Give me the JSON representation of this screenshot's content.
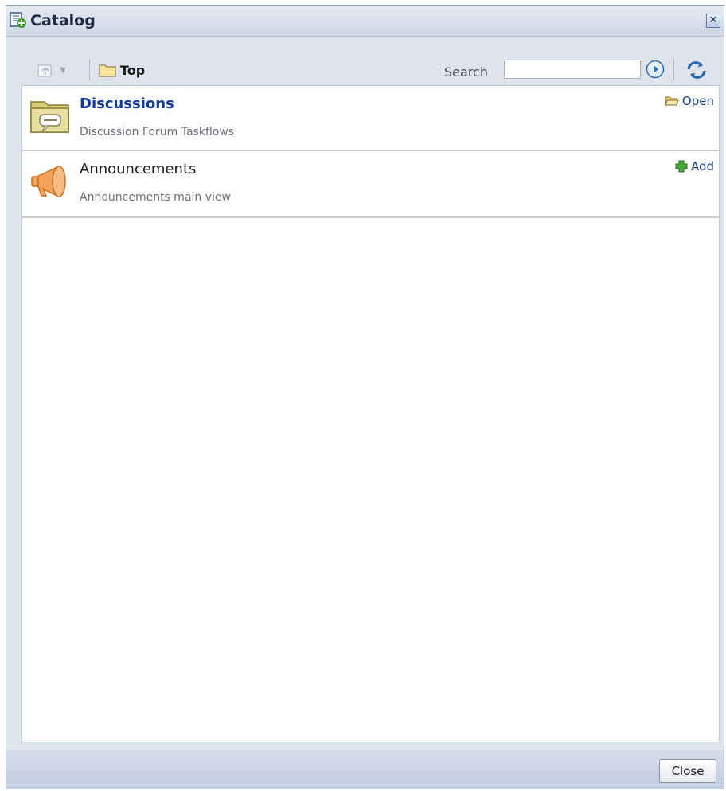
{
  "window": {
    "title": "Catalog",
    "close_icon": "close-icon"
  },
  "toolbar": {
    "up_icon": "up-folder-icon",
    "dropdown_icon": "chevron-down-icon",
    "breadcrumb_folder_icon": "folder-icon",
    "breadcrumb_label": "Top",
    "search_label": "Search",
    "search_value": "",
    "go_icon": "go-arrow-icon",
    "refresh_icon": "refresh-icon"
  },
  "items": [
    {
      "title": "Discussions",
      "description": "Discussion Forum Taskflows",
      "icon": "discussion-folder-icon",
      "action_label": "Open",
      "action_icon": "open-folder-icon"
    },
    {
      "title": "Announcements",
      "description": "Announcements main view",
      "icon": "megaphone-icon",
      "action_label": "Add",
      "action_icon": "add-plus-icon"
    }
  ],
  "footer": {
    "close_label": "Close"
  },
  "colors": {
    "link": "#0f3c9a",
    "title_bar": "#cfd6e4",
    "panel": "#dfe3ec"
  }
}
